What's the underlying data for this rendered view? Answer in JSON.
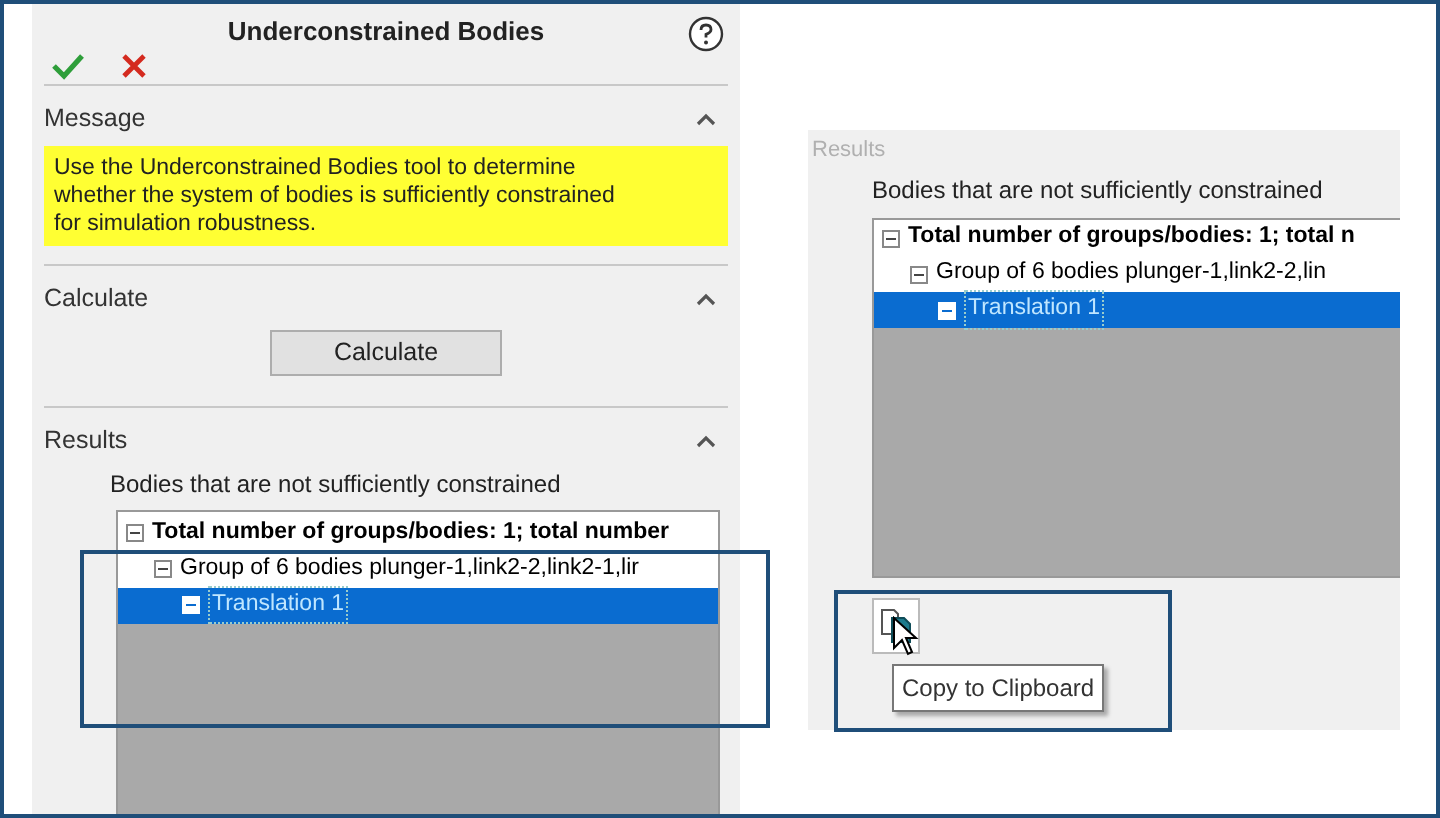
{
  "left_panel": {
    "title": "Underconstrained Bodies",
    "sections": [
      {
        "kind": "message",
        "title": "Message",
        "expanded": true,
        "text": "Use the Underconstrained Bodies tool to determine whether the system of bodies is sufficiently constrained for simulation robustness."
      },
      {
        "kind": "calculate",
        "title": "Calculate",
        "expanded": true,
        "button": "Calculate"
      },
      {
        "kind": "results",
        "title": "Results",
        "expanded": true,
        "caption": "Bodies that are not sufficiently constrained",
        "tree": [
          {
            "label": "Total number of groups/bodies: 1; total number",
            "expanded": true,
            "selected": false,
            "children": [
              {
                "label": "Group of 6 bodies plunger-1,link2-2,link2-1,lir",
                "expanded": true,
                "selected": false,
                "children": [
                  {
                    "label": "Translation 1",
                    "expanded": true,
                    "selected": true
                  }
                ]
              }
            ]
          }
        ]
      }
    ]
  },
  "right_panel": {
    "title": "Results",
    "caption": "Bodies that are not sufficiently constrained",
    "tree": [
      {
        "label": "Total number of groups/bodies: 1; total n",
        "expanded": true,
        "selected": false,
        "children": [
          {
            "label": "Group of 6 bodies plunger-1,link2-2,lin",
            "expanded": true,
            "selected": false,
            "children": [
              {
                "label": "Translation 1",
                "expanded": true,
                "selected": true
              }
            ]
          }
        ]
      }
    ],
    "tooltip": "Copy to Clipboard"
  }
}
